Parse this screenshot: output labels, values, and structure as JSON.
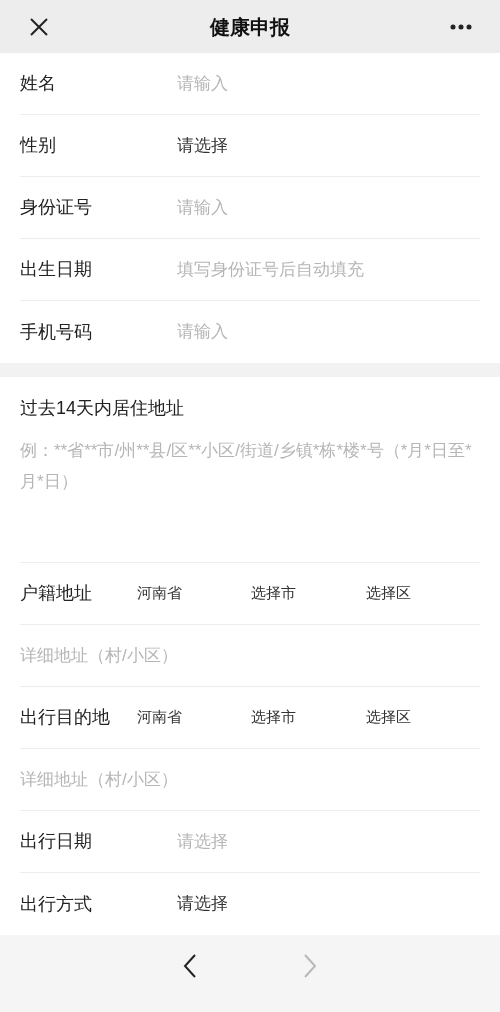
{
  "header": {
    "title": "健康申报"
  },
  "personal_fields": [
    {
      "kind": "input",
      "label": "姓名",
      "placeholder": "请输入"
    },
    {
      "kind": "select",
      "label": "性别",
      "value": "请选择"
    },
    {
      "kind": "input",
      "label": "身份证号",
      "placeholder": "请输入"
    },
    {
      "kind": "input",
      "label": "出生日期",
      "placeholder": "填写身份证号后自动填充"
    },
    {
      "kind": "input",
      "label": "手机号码",
      "placeholder": "请输入"
    }
  ],
  "residence": {
    "label": "过去14天内居住地址",
    "placeholder": "例：**省**市/州**县/区**小区/街道/乡镇*栋*楼*号（*月*日至*月*日）"
  },
  "address_fields": [
    {
      "kind": "region",
      "label": "户籍地址",
      "province": "河南省",
      "city": "选择市",
      "district": "选择区"
    },
    {
      "kind": "input",
      "placeholder": "详细地址（村/小区）"
    },
    {
      "kind": "region",
      "label": "出行目的地",
      "province": "河南省",
      "city": "选择市",
      "district": "选择区"
    },
    {
      "kind": "input",
      "placeholder": "详细地址（村/小区）"
    },
    {
      "kind": "select",
      "label": "出行日期",
      "placeholder": "请选择"
    },
    {
      "kind": "select",
      "label": "出行方式",
      "value": "请选择"
    }
  ],
  "nav": {
    "back": {
      "disabled": false
    },
    "forward": {
      "disabled": true
    }
  }
}
